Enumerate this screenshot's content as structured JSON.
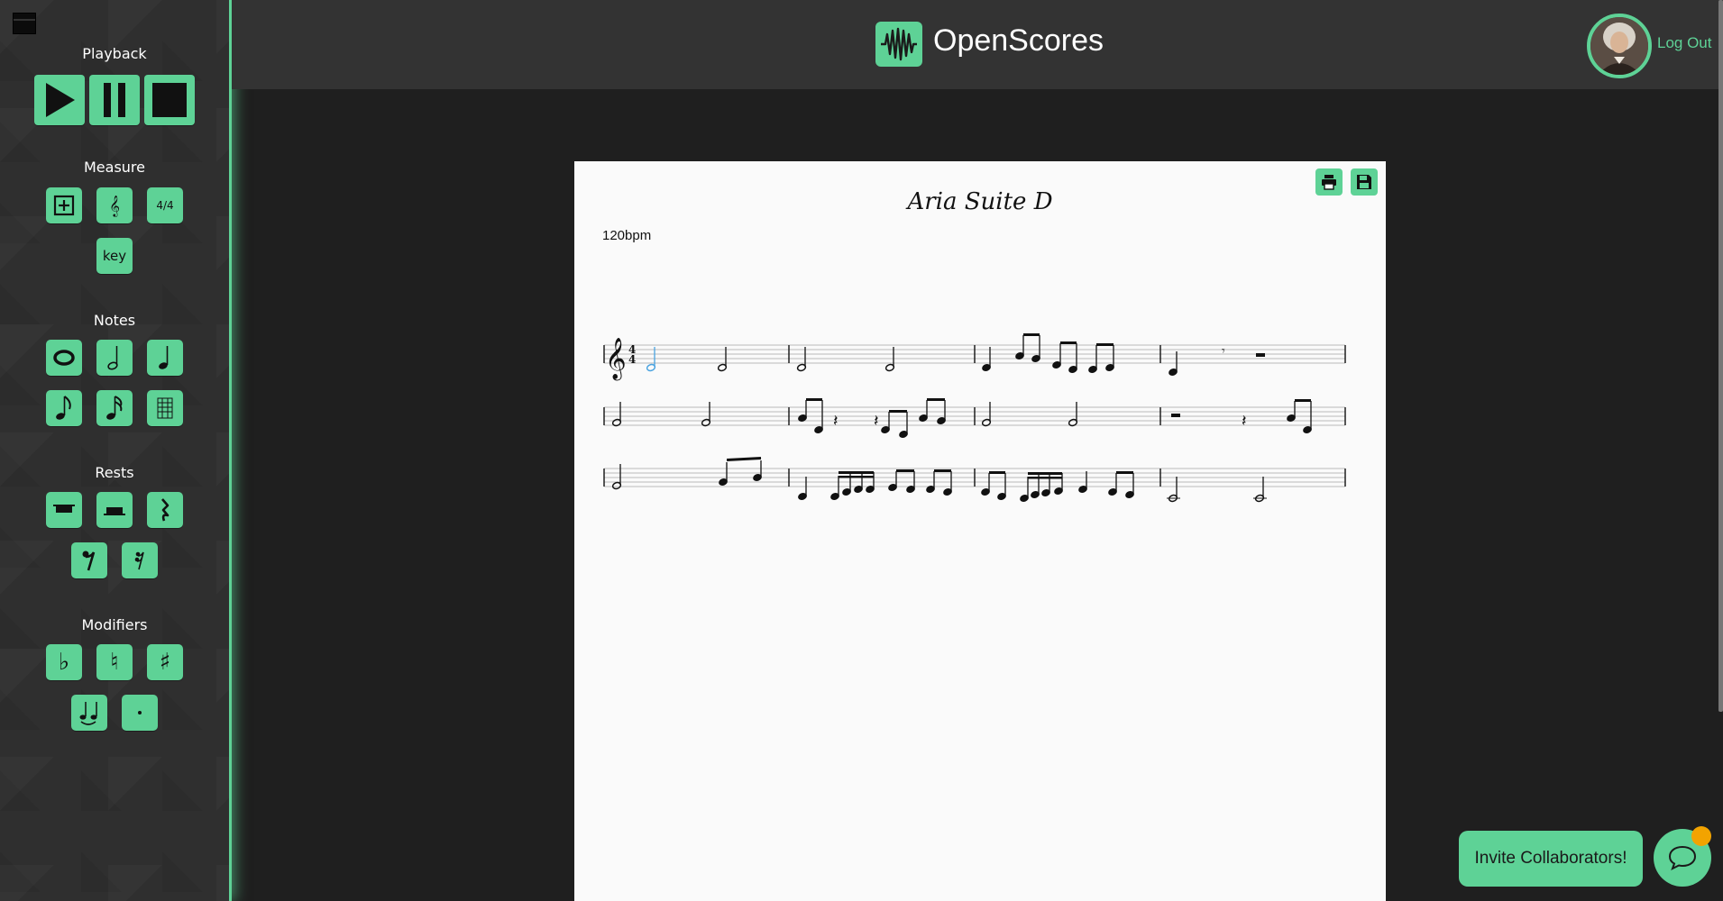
{
  "colors": {
    "accent": "#5ed296",
    "sidebar_bg": "#2f2f2f",
    "header_bg": "#333333",
    "page_bg": "#fafafa"
  },
  "sidebar": {
    "playback": {
      "title": "Playback",
      "buttons": [
        "play-icon",
        "pause-icon",
        "stop-icon"
      ]
    },
    "measure": {
      "title": "Measure",
      "add_icon": "add-measure-icon",
      "clef_icon": "treble-clef-icon",
      "time_label": "4/4",
      "key_label": "key"
    },
    "notes": {
      "title": "Notes",
      "icons": [
        "whole-note-icon",
        "half-note-icon",
        "quarter-note-icon",
        "eighth-note-icon",
        "sixteenth-note-icon",
        "thirty-second-note-icon"
      ]
    },
    "rests": {
      "title": "Rests",
      "icons": [
        "whole-rest-icon",
        "half-rest-icon",
        "quarter-rest-icon",
        "eighth-rest-icon",
        "sixteenth-rest-icon"
      ]
    },
    "modifiers": {
      "title": "Modifiers",
      "icons": [
        "flat-icon",
        "natural-icon",
        "sharp-icon",
        "tie-icon",
        "dot-icon"
      ]
    }
  },
  "header": {
    "brand": "OpenScores",
    "logout": "Log Out"
  },
  "score": {
    "title": "Aria Suite D",
    "tempo": "120bpm",
    "time_signature": "4/4"
  },
  "bottom": {
    "invite_label": "Invite Collaborators!"
  }
}
